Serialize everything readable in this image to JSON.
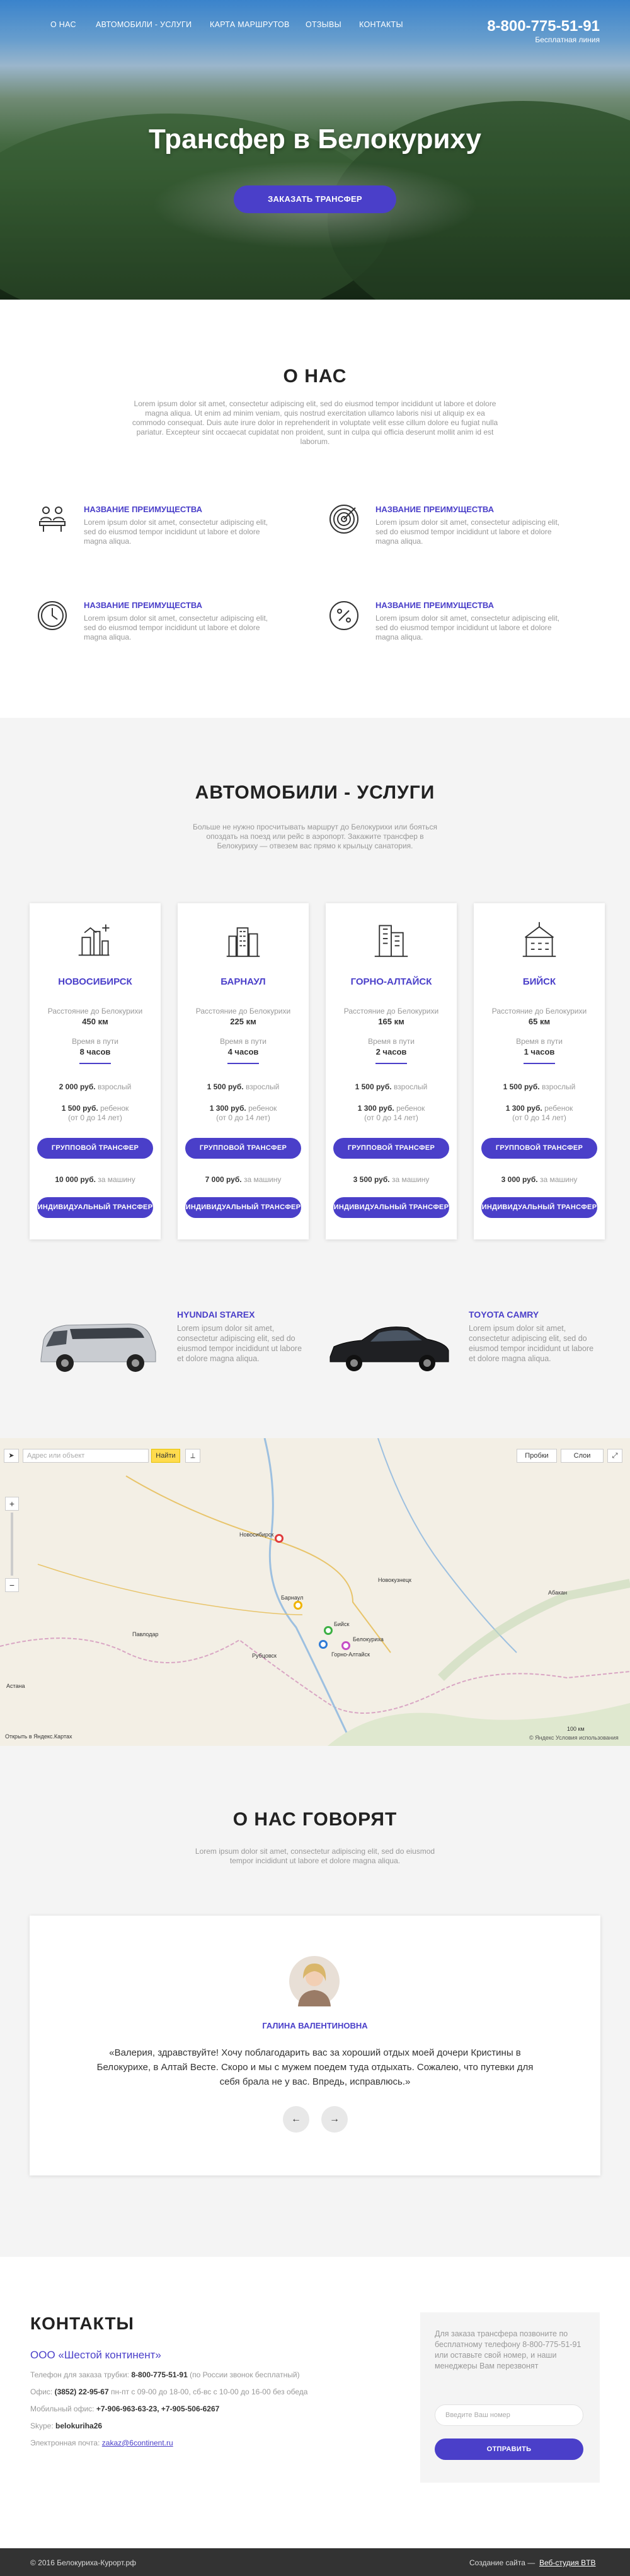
{
  "nav": {
    "items": [
      "О НАС",
      "АВТОМОБИЛИ - УСЛУГИ",
      "КАРТА МАРШРУТОВ",
      "ОТЗЫВЫ",
      "КОНТАКТЫ"
    ],
    "phone": "8-800-775-51-91",
    "phone_sub": "Бесплатная линия"
  },
  "hero": {
    "title": "Трансфер в Белокуриху",
    "button": "ЗАКАЗАТЬ ТРАНСФЕР"
  },
  "about": {
    "title": "О НАС",
    "text": "Lorem ipsum dolor sit amet, consectetur adipiscing elit, sed do eiusmod tempor incididunt ut labore et dolore magna aliqua. Ut enim ad minim veniam, quis nostrud exercitation ullamco laboris nisi ut aliquip ex ea commodo consequat. Duis aute irure dolor in reprehenderit in voluptate velit esse cillum dolore eu fugiat nulla pariatur. Excepteur sint occaecat cupidatat non proident, sunt in culpa qui officia deserunt mollit anim id est laborum.",
    "features": [
      {
        "icon": "team-icon",
        "title": "НАЗВАНИЕ ПРЕИМУЩЕСТВА",
        "text": "Lorem ipsum dolor sit amet, consectetur adipiscing elit, sed do eiusmod tempor incididunt ut labore et dolore magna aliqua."
      },
      {
        "icon": "target-icon",
        "title": "НАЗВАНИЕ ПРЕИМУЩЕСТВА",
        "text": "Lorem ipsum dolor sit amet, consectetur adipiscing elit, sed do eiusmod tempor incididunt ut labore et dolore magna aliqua."
      },
      {
        "icon": "clock-icon",
        "title": "НАЗВАНИЕ ПРЕИМУЩЕСТВА",
        "text": "Lorem ipsum dolor sit amet, consectetur adipiscing elit, sed do eiusmod tempor incididunt ut labore et dolore magna aliqua."
      },
      {
        "icon": "percent-icon",
        "title": "НАЗВАНИЕ ПРЕИМУЩЕСТВА",
        "text": "Lorem ipsum dolor sit amet, consectetur adipiscing elit, sed do eiusmod tempor incididunt ut labore et dolore magna aliqua."
      }
    ]
  },
  "services": {
    "title": "АВТОМОБИЛИ - УСЛУГИ",
    "text": "Больше не нужно просчитывать маршрут до Белокурихи или бояться опоздать на поезд или рейс в аэропорт. Закажите трансфер в Белокуриху — отвезем вас прямо к крыльцу санатория.",
    "distance_label": "Расстояние до Белокурихи",
    "time_label": "Время в пути",
    "group_btn": "ГРУППОВОЙ ТРАНСФЕР",
    "ind_btn": "ИНДИВИДУАЛЬНЫЙ ТРАНСФЕР",
    "adult": "взрослый",
    "child": "ребенок",
    "child_note": "(от 0 до 14 лет)",
    "per_car": "за машину",
    "cities": [
      {
        "name": "НОВОСИБИРСК",
        "distance": "450 км",
        "time": "8 часов",
        "adult_price": "2 000 руб.",
        "child_price": "1 500 руб.",
        "car_price": "10 000 руб."
      },
      {
        "name": "БАРНАУЛ",
        "distance": "225 км",
        "time": "4 часов",
        "adult_price": "1 500 руб.",
        "child_price": "1 300 руб.",
        "car_price": "7 000 руб."
      },
      {
        "name": "ГОРНО-АЛТАЙСК",
        "distance": "165 км",
        "time": "2 часов",
        "adult_price": "1 500 руб.",
        "child_price": "1 300 руб.",
        "car_price": "3 500 руб."
      },
      {
        "name": "БИЙСК",
        "distance": "65 км",
        "time": "1 часов",
        "adult_price": "1 500 руб.",
        "child_price": "1 300 руб.",
        "car_price": "3 000 руб."
      }
    ],
    "cars": [
      {
        "name": "HYUNDAI STAREX",
        "text": "Lorem ipsum dolor sit amet, consectetur adipiscing elit, sed do eiusmod tempor incididunt ut labore et dolore magna aliqua."
      },
      {
        "name": "TOYOTA CAMRY",
        "text": "Lorem ipsum dolor sit amet, consectetur adipiscing elit, sed do eiusmod tempor incididunt ut labore et dolore magna aliqua."
      }
    ]
  },
  "map": {
    "search_placeholder": "Адрес или объект",
    "find_btn": "Найти",
    "traffic": "Пробки",
    "layers": "Слои",
    "open_link": "Открыть в Яндекс.Картах",
    "copyright": "© Яндекс Условия использования",
    "scale": "100 км",
    "cities": [
      "Новосибирск",
      "Барнаул",
      "Бийск",
      "Горно-Алтайск",
      "Белокуриха",
      "Астана",
      "Павлодар",
      "Рубцовск",
      "Новокузнецк",
      "Абакан"
    ]
  },
  "reviews": {
    "title": "О НАС ГОВОРЯТ",
    "text": "Lorem ipsum dolor sit amet, consectetur adipiscing elit, sed do eiusmod tempor incididunt ut labore et dolore magna aliqua.",
    "author": "ГАЛИНА ВАЛЕНТИНОВНА",
    "quote": "«Валерия, здравствуйте! Хочу поблагодарить вас за хороший отдых моей дочери Кристины в Белокурихе, в Алтай Весте. Скоро и мы с мужем поедем туда отдыхать. Сожалею, что путевки для себя брала не у вас. Впредь, исправлюсь.»",
    "prev": "←",
    "next": "→"
  },
  "contacts": {
    "title": "КОНТАКТЫ",
    "company": "ООО «Шестой континент»",
    "rows": [
      {
        "label": "Телефон для заказа трубки:",
        "value": "8-800-775-51-91",
        "note": "(по России звонок бесплатный)"
      },
      {
        "label": "Офис:",
        "value": "(3852) 22-95-67",
        "note": "пн-пт с 09-00 до 18-00, сб-вс с 10-00 до 16-00 без обеда"
      },
      {
        "label": "Мобильный офис:",
        "value": "+7-906-963-63-23, +7-905-506-6267",
        "note": ""
      },
      {
        "label": "Skype:",
        "value": "belokuriha26",
        "note": ""
      },
      {
        "label": "Электронная почта:",
        "value": "zakaz@6continent.ru",
        "note": ""
      }
    ],
    "form_text": "Для заказа трансфера позвоните по бесплатному телефону 8-800-775-51-91 или оставьте свой номер, и наши менеджеры Вам перезвонят",
    "form_placeholder": "Введите Ваш номер",
    "form_btn": "ОТПРАВИТЬ"
  },
  "footer": {
    "left": "© 2016 Белокуриха-Курорт.рф",
    "right_label": "Создание сайта —",
    "right_link": "Веб-студия BTB"
  },
  "colors": {
    "accent": "#4a3fc9",
    "bg_gray": "#f4f4f4",
    "footer": "#333333"
  }
}
